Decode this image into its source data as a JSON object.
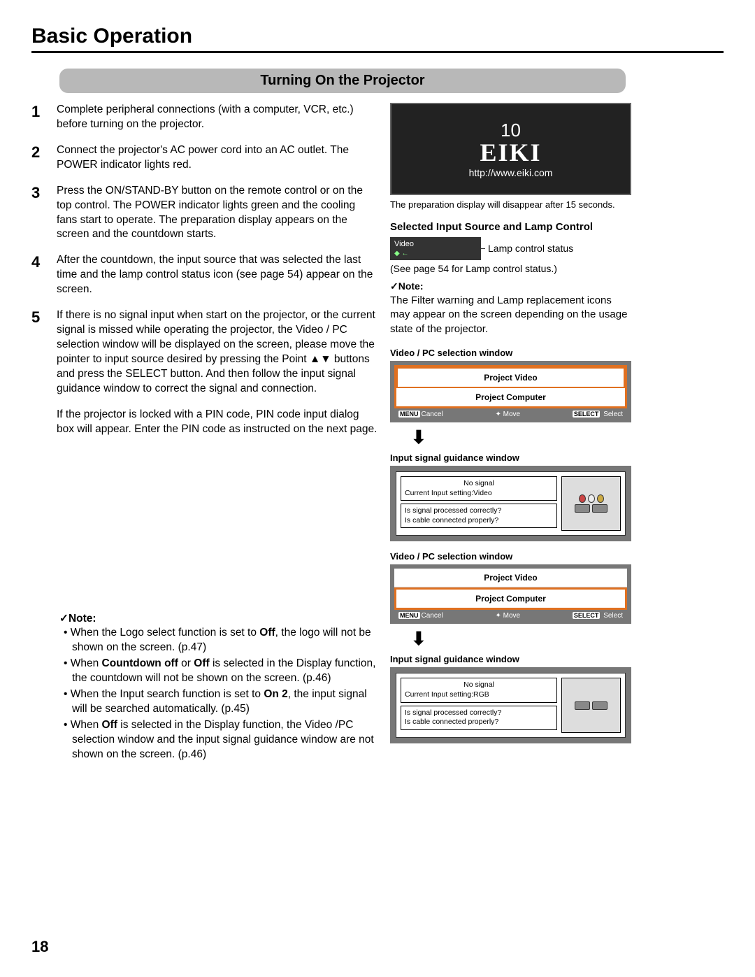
{
  "pageTitle": "Basic Operation",
  "sectionTitle": "Turning On the Projector",
  "pageNumber": "18",
  "steps": [
    {
      "num": "1",
      "text": "Complete peripheral connections (with a computer, VCR, etc.) before turning on the projector."
    },
    {
      "num": "2",
      "text": "Connect the projector's AC power cord into an AC outlet. The POWER indicator lights red."
    },
    {
      "num": "3",
      "text": "Press the ON/STAND-BY button on the remote control or on the top control. The POWER indicator lights green and the cooling fans start to operate. The preparation display appears on the screen and the countdown starts."
    },
    {
      "num": "4",
      "text": "After the countdown, the input source that was selected the last time and the lamp control status icon (see page 54) appear on the screen."
    },
    {
      "num": "5",
      "text": "If there is no signal input when start on the projector, or the current signal is missed while operating the projector, the Video / PC selection window will be displayed on the screen, please move the pointer to input source desired by pressing the Point ▲▼ buttons and press the SELECT button. And then follow the input signal guidance window to correct the signal and connection."
    }
  ],
  "extraPara": "If the projector is locked with a PIN code, PIN code input dialog box will appear. Enter the PIN code as instructed on the next page.",
  "leftNoteLabel": "✓Note:",
  "leftNotes": {
    "n1a": "When the Logo select function is set to ",
    "n1b": "Off",
    "n1c": ", the logo will not be shown on the screen.  (p.47)",
    "n2a": "When ",
    "n2b": "Countdown off",
    "n2c": " or ",
    "n2d": "Off",
    "n2e": " is selected in the Display function, the countdown will not be shown on the screen. (p.46)",
    "n3a": "When the Input search function is set to ",
    "n3b": "On 2",
    "n3c": ", the input signal will be searched automatically.  (p.45)",
    "n4a": "When ",
    "n4b": "Off",
    "n4c": " is selected in the Display function, the Video /PC selection window and the input signal guidance window are not shown on the screen.  (p.46)"
  },
  "prep": {
    "count": "10",
    "logo": "EIKI",
    "url": "http://www.eiki.com"
  },
  "prepCaption": "The preparation display will disappear after 15 seconds.",
  "lampHeading": "Selected Input Source and Lamp Control",
  "lampBox": {
    "video": "Video"
  },
  "lampLabel": "Lamp control status",
  "lampSee": "(See page 54 for Lamp control status.)",
  "rightNoteLabel": "✓Note:",
  "rightNoteText": "The Filter warning and Lamp replacement icons may appear on the screen depending on the usage state of the projector.",
  "winLabels": {
    "sel1": "Video / PC selection window",
    "guide1": "Input signal guidance window",
    "sel2": "Video / PC selection window",
    "guide2": "Input signal guidance window"
  },
  "selWin": {
    "video": "Project Video",
    "computer": "Project Computer",
    "cancel": "Cancel",
    "move": "Move",
    "select": "Select"
  },
  "guide1": {
    "noSignal": "No signal",
    "current": "Current Input setting:Video",
    "q1": "Is signal processed correctly?",
    "q2": "Is cable connected properly?"
  },
  "guide2": {
    "noSignal": "No signal",
    "current": "Current Input setting:RGB",
    "q1": "Is signal processed correctly?",
    "q2": "Is cable connected properly?"
  }
}
